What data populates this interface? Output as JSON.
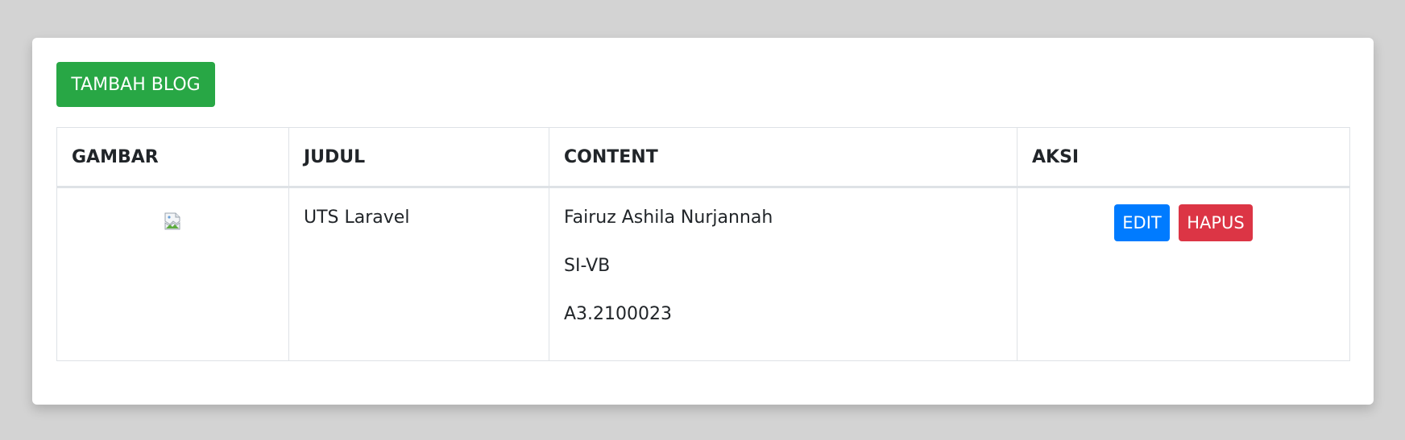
{
  "toolbar": {
    "add_label": "TAMBAH BLOG"
  },
  "table": {
    "headers": [
      "GAMBAR",
      "JUDUL",
      "CONTENT",
      "AKSI"
    ],
    "rows": [
      {
        "judul": "UTS Laravel",
        "content_lines": [
          "Fairuz Ashila Nurjannah",
          "SI-VB",
          "A3.2100023"
        ],
        "edit_label": "EDIT",
        "delete_label": "HAPUS"
      }
    ]
  },
  "colors": {
    "page_bg": "#d3d3d3",
    "add_button": "#28a745",
    "edit_button": "#007bff",
    "delete_button": "#dc3545"
  },
  "icons": {
    "image_placeholder": "broken-image-icon"
  }
}
